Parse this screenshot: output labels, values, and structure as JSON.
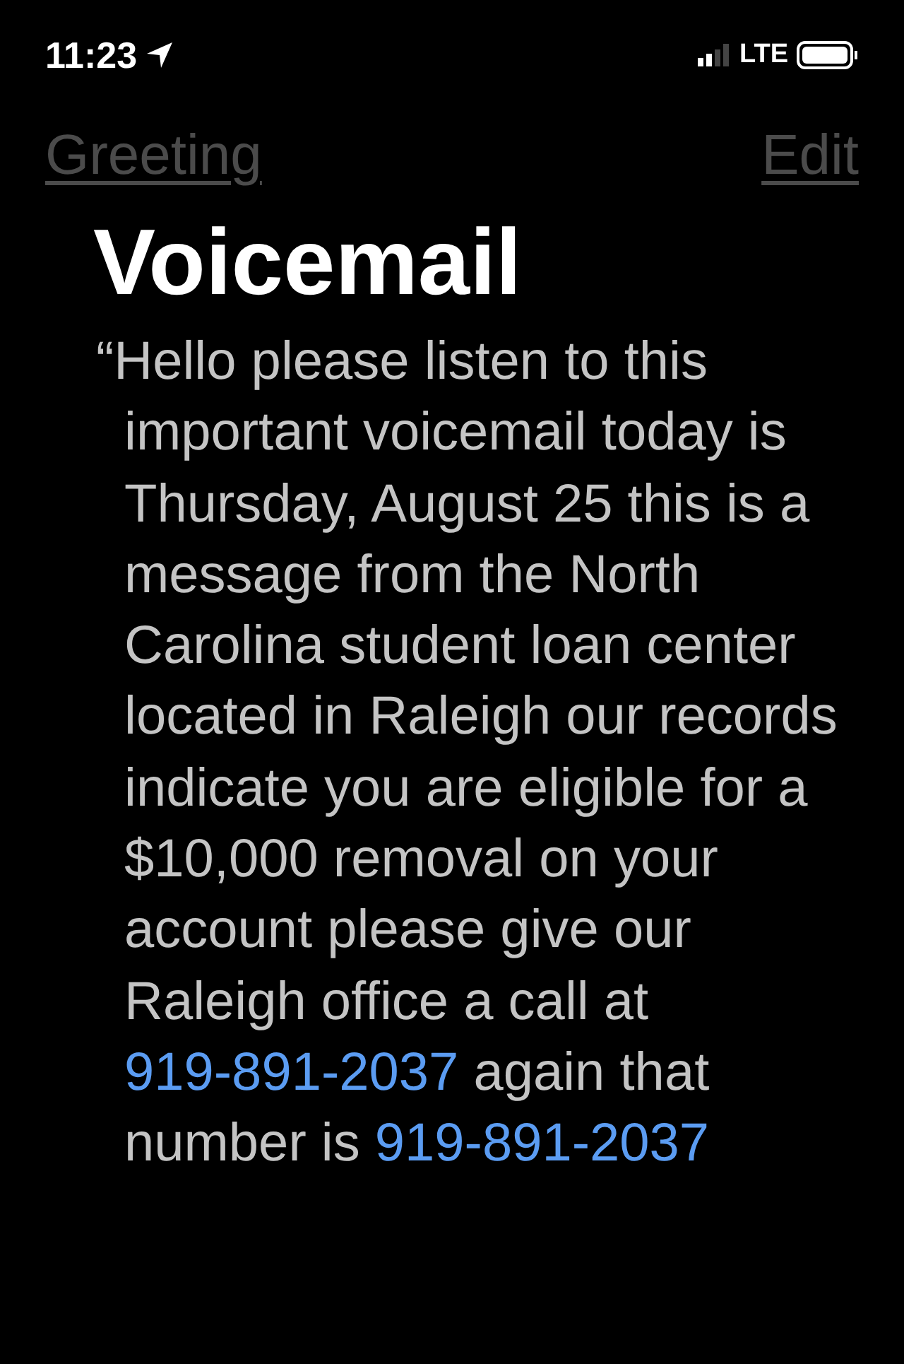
{
  "status_bar": {
    "time": "11:23",
    "network": "LTE"
  },
  "nav": {
    "back": "Greeting",
    "action": "Edit"
  },
  "title": "Voicemail",
  "transcript": [
    {
      "kind": "text",
      "text": "“Hello please listen to this important voicemail today is Thursday, August 25 this is a message from the North Carolina student loan center located in Raleigh our records indicate you are eligible for a $10,000 removal on your account please give our Raleigh office a call at "
    },
    {
      "kind": "phone",
      "text": "919-891-2037"
    },
    {
      "kind": "text",
      "text": " again that number is "
    },
    {
      "kind": "phone",
      "text": "919-891-2037"
    }
  ]
}
